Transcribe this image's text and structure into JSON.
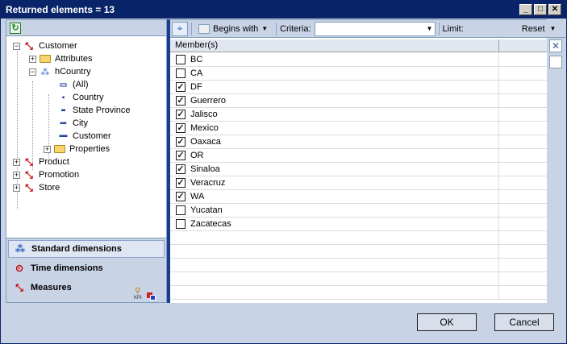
{
  "window": {
    "title": "Returned elements = 13"
  },
  "tree": {
    "items": [
      {
        "label": "Customer",
        "x": 0
      },
      {
        "label": "Attributes",
        "x": 0
      },
      {
        "label": "hCountry",
        "x": 0
      },
      {
        "label": "(All)",
        "x": 0
      },
      {
        "label": "Country",
        "x": 0
      },
      {
        "label": "State Province",
        "x": 0
      },
      {
        "label": "City",
        "x": 0
      },
      {
        "label": "Customer",
        "x": 0
      },
      {
        "label": "Properties",
        "x": 0
      },
      {
        "label": "Product",
        "x": 0
      },
      {
        "label": "Promotion",
        "x": 0
      },
      {
        "label": "Store",
        "x": 0
      }
    ]
  },
  "nav": {
    "standard": "Standard dimensions",
    "time": "Time dimensions",
    "measures": "Measures",
    "kpi_label": "KPI"
  },
  "toolbar": {
    "begins_with": "Begins with",
    "criteria_label": "Criteria:",
    "criteria_value": "",
    "limit_label": "Limit:",
    "reset": "Reset"
  },
  "grid": {
    "header": "Member(s)",
    "rows": [
      {
        "label": "BC",
        "checked": false
      },
      {
        "label": "CA",
        "checked": false
      },
      {
        "label": "DF",
        "checked": true
      },
      {
        "label": "Guerrero",
        "checked": true
      },
      {
        "label": "Jalisco",
        "checked": true
      },
      {
        "label": "Mexico",
        "checked": true
      },
      {
        "label": "Oaxaca",
        "checked": true
      },
      {
        "label": "OR",
        "checked": true
      },
      {
        "label": "Sinaloa",
        "checked": true
      },
      {
        "label": "Veracruz",
        "checked": true
      },
      {
        "label": "WA",
        "checked": true
      },
      {
        "label": "Yucatan",
        "checked": false
      },
      {
        "label": "Zacatecas",
        "checked": false
      }
    ]
  },
  "footer": {
    "ok": "OK",
    "cancel": "Cancel"
  }
}
